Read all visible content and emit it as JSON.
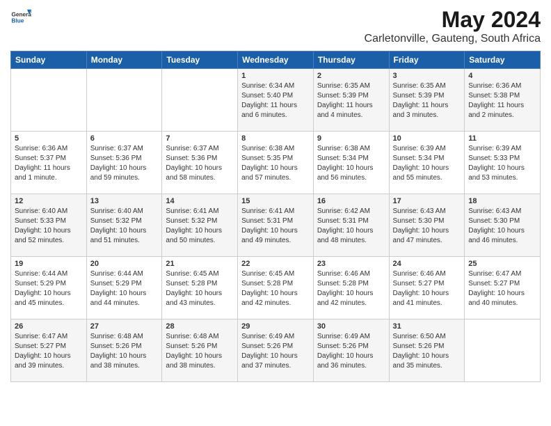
{
  "header": {
    "logo": {
      "general": "General",
      "blue": "Blue"
    },
    "title": "May 2024",
    "subtitle": "Carletonville, Gauteng, South Africa"
  },
  "days_of_week": [
    "Sunday",
    "Monday",
    "Tuesday",
    "Wednesday",
    "Thursday",
    "Friday",
    "Saturday"
  ],
  "weeks": [
    {
      "days": [
        {
          "number": "",
          "info": ""
        },
        {
          "number": "",
          "info": ""
        },
        {
          "number": "",
          "info": ""
        },
        {
          "number": "1",
          "info": "Sunrise: 6:34 AM\nSunset: 5:40 PM\nDaylight: 11 hours and 6 minutes."
        },
        {
          "number": "2",
          "info": "Sunrise: 6:35 AM\nSunset: 5:39 PM\nDaylight: 11 hours and 4 minutes."
        },
        {
          "number": "3",
          "info": "Sunrise: 6:35 AM\nSunset: 5:39 PM\nDaylight: 11 hours and 3 minutes."
        },
        {
          "number": "4",
          "info": "Sunrise: 6:36 AM\nSunset: 5:38 PM\nDaylight: 11 hours and 2 minutes."
        }
      ]
    },
    {
      "days": [
        {
          "number": "5",
          "info": "Sunrise: 6:36 AM\nSunset: 5:37 PM\nDaylight: 11 hours and 1 minute."
        },
        {
          "number": "6",
          "info": "Sunrise: 6:37 AM\nSunset: 5:36 PM\nDaylight: 10 hours and 59 minutes."
        },
        {
          "number": "7",
          "info": "Sunrise: 6:37 AM\nSunset: 5:36 PM\nDaylight: 10 hours and 58 minutes."
        },
        {
          "number": "8",
          "info": "Sunrise: 6:38 AM\nSunset: 5:35 PM\nDaylight: 10 hours and 57 minutes."
        },
        {
          "number": "9",
          "info": "Sunrise: 6:38 AM\nSunset: 5:34 PM\nDaylight: 10 hours and 56 minutes."
        },
        {
          "number": "10",
          "info": "Sunrise: 6:39 AM\nSunset: 5:34 PM\nDaylight: 10 hours and 55 minutes."
        },
        {
          "number": "11",
          "info": "Sunrise: 6:39 AM\nSunset: 5:33 PM\nDaylight: 10 hours and 53 minutes."
        }
      ]
    },
    {
      "days": [
        {
          "number": "12",
          "info": "Sunrise: 6:40 AM\nSunset: 5:33 PM\nDaylight: 10 hours and 52 minutes."
        },
        {
          "number": "13",
          "info": "Sunrise: 6:40 AM\nSunset: 5:32 PM\nDaylight: 10 hours and 51 minutes."
        },
        {
          "number": "14",
          "info": "Sunrise: 6:41 AM\nSunset: 5:32 PM\nDaylight: 10 hours and 50 minutes."
        },
        {
          "number": "15",
          "info": "Sunrise: 6:41 AM\nSunset: 5:31 PM\nDaylight: 10 hours and 49 minutes."
        },
        {
          "number": "16",
          "info": "Sunrise: 6:42 AM\nSunset: 5:31 PM\nDaylight: 10 hours and 48 minutes."
        },
        {
          "number": "17",
          "info": "Sunrise: 6:43 AM\nSunset: 5:30 PM\nDaylight: 10 hours and 47 minutes."
        },
        {
          "number": "18",
          "info": "Sunrise: 6:43 AM\nSunset: 5:30 PM\nDaylight: 10 hours and 46 minutes."
        }
      ]
    },
    {
      "days": [
        {
          "number": "19",
          "info": "Sunrise: 6:44 AM\nSunset: 5:29 PM\nDaylight: 10 hours and 45 minutes."
        },
        {
          "number": "20",
          "info": "Sunrise: 6:44 AM\nSunset: 5:29 PM\nDaylight: 10 hours and 44 minutes."
        },
        {
          "number": "21",
          "info": "Sunrise: 6:45 AM\nSunset: 5:28 PM\nDaylight: 10 hours and 43 minutes."
        },
        {
          "number": "22",
          "info": "Sunrise: 6:45 AM\nSunset: 5:28 PM\nDaylight: 10 hours and 42 minutes."
        },
        {
          "number": "23",
          "info": "Sunrise: 6:46 AM\nSunset: 5:28 PM\nDaylight: 10 hours and 42 minutes."
        },
        {
          "number": "24",
          "info": "Sunrise: 6:46 AM\nSunset: 5:27 PM\nDaylight: 10 hours and 41 minutes."
        },
        {
          "number": "25",
          "info": "Sunrise: 6:47 AM\nSunset: 5:27 PM\nDaylight: 10 hours and 40 minutes."
        }
      ]
    },
    {
      "days": [
        {
          "number": "26",
          "info": "Sunrise: 6:47 AM\nSunset: 5:27 PM\nDaylight: 10 hours and 39 minutes."
        },
        {
          "number": "27",
          "info": "Sunrise: 6:48 AM\nSunset: 5:26 PM\nDaylight: 10 hours and 38 minutes."
        },
        {
          "number": "28",
          "info": "Sunrise: 6:48 AM\nSunset: 5:26 PM\nDaylight: 10 hours and 38 minutes."
        },
        {
          "number": "29",
          "info": "Sunrise: 6:49 AM\nSunset: 5:26 PM\nDaylight: 10 hours and 37 minutes."
        },
        {
          "number": "30",
          "info": "Sunrise: 6:49 AM\nSunset: 5:26 PM\nDaylight: 10 hours and 36 minutes."
        },
        {
          "number": "31",
          "info": "Sunrise: 6:50 AM\nSunset: 5:26 PM\nDaylight: 10 hours and 35 minutes."
        },
        {
          "number": "",
          "info": ""
        }
      ]
    }
  ]
}
